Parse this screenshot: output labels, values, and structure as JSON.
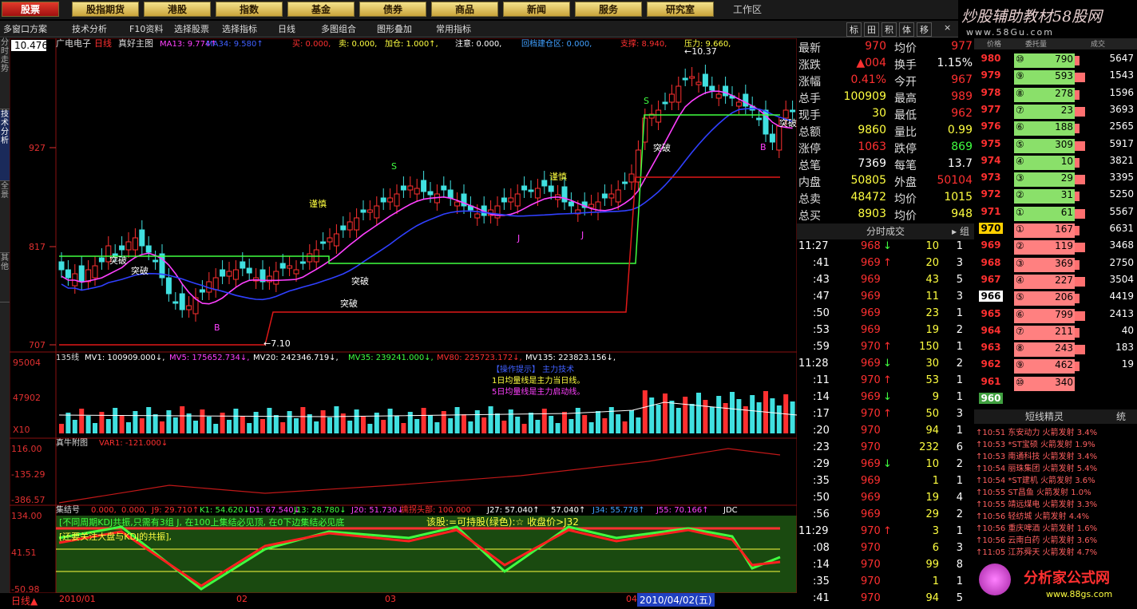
{
  "nav": {
    "items": [
      "股票",
      "股指期货",
      "港股",
      "指数",
      "基金",
      "债券",
      "商品",
      "新闻",
      "服务",
      "研究室"
    ],
    "active": 0,
    "workspace": "工作区"
  },
  "brand": {
    "text": "炒股辅助教材58股网",
    "sub": "www.58Gu.com"
  },
  "toolbar": {
    "items": [
      "多窗口方案",
      "技术分析",
      "F10资料",
      "选择股票",
      "选择指标",
      "日线",
      "多图组合",
      "图形叠加",
      "常用指标"
    ],
    "right_tools": [
      "标",
      "田",
      "积",
      "体",
      "移"
    ],
    "close": "×"
  },
  "sidebar": {
    "tabs": [
      "分时走势",
      "技术分析",
      "全景",
      "其他"
    ]
  },
  "main": {
    "price_label": "10.476",
    "title_stock": "广电电子",
    "title_period": "日线",
    "title_main": "真好主图",
    "indicators": [
      {
        "text": "MA13: 9.774↑",
        "color": "#ff40ff"
      },
      {
        "text": "MA34:  9.580↑",
        "color": "#4060ff"
      },
      {
        "text": "买: 0.000,",
        "color": "#ff3030"
      },
      {
        "text": "卖: 0.000,",
        "color": "#ffff40"
      },
      {
        "text": "加仓: 1.000↑,",
        "color": "#ffff40"
      },
      {
        "text": "注意: 0.000,",
        "color": "#ffffff"
      },
      {
        "text": "回档建仓区: 0.000,",
        "color": "#40a0ff"
      },
      {
        "text": "支撑: 8.940,",
        "color": "#ff3030"
      },
      {
        "text": "压力: 9.660,",
        "color": "#ffff40"
      }
    ],
    "y_ticks": [
      "927",
      "817",
      "707"
    ],
    "annotations": {
      "high": "10.37",
      "low": "7.10",
      "tupo": "突破",
      "jinshen": "谨慎",
      "s_mark": "S",
      "b_mark": "B",
      "j_mark": "J"
    }
  },
  "volume": {
    "title": "135线",
    "ind": [
      {
        "text": "MV1: 100909.000↓,",
        "color": "#ffffff"
      },
      {
        "text": "MV5: 175652.734↓,",
        "color": "#ff40ff"
      },
      {
        "text": "MV20: 242346.719↓,",
        "color": "#ffffff"
      },
      {
        "text": "MV35: 239241.000↓,",
        "color": "#40ff40"
      },
      {
        "text": "MV80: 225723.172↓,",
        "color": "#ff3030"
      },
      {
        "text": "MV135: 223823.156↓,",
        "color": "#ffffff"
      }
    ],
    "y_ticks": [
      "95004",
      "47902",
      "X10"
    ],
    "legend": [
      "【操作提示】 主力技术",
      "1日均量线是主力当日线。",
      "5日均量线是主力启动线。"
    ]
  },
  "sub1": {
    "title": "真牛附图",
    "ind": "VAR1: -121.000↓",
    "y_ticks": [
      "116.00",
      "-135.29",
      "-386.57"
    ]
  },
  "sub2": {
    "title": "集结号",
    "ind": [
      {
        "text": "0.000,",
        "color": "#ff3030"
      },
      {
        "text": "0.000,",
        "color": "#ff3030"
      },
      {
        "text": "J9: 29.710↑",
        "color": "#ff3030"
      },
      {
        "text": "K1: 54.620↓",
        "color": "#40ff40"
      },
      {
        "text": "D1: 67.540↓",
        "color": "#ff40ff"
      },
      {
        "text": "J13: 28.780↓",
        "color": "#40ff40"
      },
      {
        "text": "J20: 51.730↓",
        "color": "#ff40ff"
      },
      {
        "text": "擒拐头部: 100.000",
        "color": "#ff3030"
      },
      {
        "text": "J27: 57.040↑",
        "color": "#ffffff"
      },
      {
        "text": "57.040↑",
        "color": "#ffffff"
      },
      {
        "text": "J34: 55.778↑",
        "color": "#40a0ff"
      },
      {
        "text": "J55: 70.166↑",
        "color": "#ff40ff"
      },
      {
        "text": "JDC",
        "color": "#ffffff"
      }
    ],
    "y_ticks": [
      "134.00",
      "41.51",
      "-50.98"
    ],
    "text1": "[不同周期KDJ共振,只需有3组 J, 在100上集结必见顶, 在0下边集结必见底",
    "text2": "该股:=可持股(绿色):☆  收盘价>J32",
    "text3": "[还要关注大盘与KDJ的共振],"
  },
  "bottom": {
    "period": "日线▲",
    "dates": [
      "2010/01",
      "02",
      "03",
      "04"
    ],
    "cursor_date": "2010/04/02(五)"
  },
  "quote": {
    "rows": [
      {
        "l": "最新",
        "v": "970",
        "vc": "#ff3030",
        "l2": "均价",
        "v2": "977",
        "v2c": "#ff3030"
      },
      {
        "l": "涨跌",
        "v": "▲004",
        "vc": "#ff3030",
        "l2": "换手",
        "v2": "1.15%",
        "v2c": "#ffffff"
      },
      {
        "l": "涨幅",
        "v": "0.41%",
        "vc": "#ff3030",
        "l2": "今开",
        "v2": "967",
        "v2c": "#ff3030"
      },
      {
        "l": "总手",
        "v": "100909",
        "vc": "#ffff40",
        "l2": "最高",
        "v2": "989",
        "v2c": "#ff3030"
      },
      {
        "l": "现手",
        "v": "30",
        "vc": "#ffff40",
        "l2": "最低",
        "v2": "962",
        "v2c": "#ff3030"
      },
      {
        "l": "总额",
        "v": "9860",
        "vc": "#ffff40",
        "l2": "量比",
        "v2": "0.99",
        "v2c": "#ffff40"
      },
      {
        "l": "涨停",
        "v": "1063",
        "vc": "#ff3030",
        "l2": "跌停",
        "v2": "869",
        "v2c": "#40ff40"
      },
      {
        "l": "总笔",
        "v": "7369",
        "vc": "#ffffff",
        "l2": "每笔",
        "v2": "13.7",
        "v2c": "#ffffff"
      },
      {
        "l": "内盘",
        "v": "50805",
        "vc": "#ffff40",
        "l2": "外盘",
        "v2": "50104",
        "v2c": "#ff3030"
      },
      {
        "l": "总卖",
        "v": "48472",
        "vc": "#ffff40",
        "l2": "均价",
        "v2": "1015",
        "v2c": "#ffff40"
      },
      {
        "l": "总买",
        "v": "8903",
        "vc": "#ffff40",
        "l2": "均价",
        "v2": "948",
        "v2c": "#ffff40"
      }
    ]
  },
  "trades": {
    "header": "分时成交",
    "side": "组",
    "rows": [
      {
        "t": "11:27",
        "p": "968",
        "a": "↓",
        "v": "10",
        "n": "1"
      },
      {
        "t": ":41",
        "p": "969",
        "a": "↑",
        "v": "20",
        "n": "3"
      },
      {
        "t": ":43",
        "p": "969",
        "a": "",
        "v": "43",
        "n": "5"
      },
      {
        "t": ":47",
        "p": "969",
        "a": "",
        "v": "11",
        "n": "3"
      },
      {
        "t": ":50",
        "p": "969",
        "a": "",
        "v": "23",
        "n": "1"
      },
      {
        "t": ":53",
        "p": "969",
        "a": "",
        "v": "19",
        "n": "2"
      },
      {
        "t": ":59",
        "p": "970",
        "a": "↑",
        "v": "150",
        "n": "1"
      },
      {
        "t": "11:28",
        "p": "969",
        "a": "↓",
        "v": "30",
        "n": "2"
      },
      {
        "t": ":11",
        "p": "970",
        "a": "↑",
        "v": "53",
        "n": "1"
      },
      {
        "t": ":14",
        "p": "969",
        "a": "↓",
        "v": "9",
        "n": "1"
      },
      {
        "t": ":17",
        "p": "970",
        "a": "↑",
        "v": "50",
        "n": "3"
      },
      {
        "t": ":20",
        "p": "970",
        "a": "",
        "v": "94",
        "n": "1"
      },
      {
        "t": ":23",
        "p": "970",
        "a": "",
        "v": "232",
        "n": "6"
      },
      {
        "t": ":29",
        "p": "969",
        "a": "↓",
        "v": "10",
        "n": "2"
      },
      {
        "t": ":35",
        "p": "969",
        "a": "",
        "v": "1",
        "n": "1"
      },
      {
        "t": ":50",
        "p": "969",
        "a": "",
        "v": "19",
        "n": "4"
      },
      {
        "t": ":56",
        "p": "969",
        "a": "",
        "v": "29",
        "n": "2"
      },
      {
        "t": "11:29",
        "p": "970",
        "a": "↑",
        "v": "3",
        "n": "1"
      },
      {
        "t": ":08",
        "p": "970",
        "a": "",
        "v": "6",
        "n": "3"
      },
      {
        "t": ":14",
        "p": "970",
        "a": "",
        "v": "99",
        "n": "8"
      },
      {
        "t": ":35",
        "p": "970",
        "a": "",
        "v": "1",
        "n": "1"
      },
      {
        "t": ":41",
        "p": "970",
        "a": "",
        "v": "94",
        "n": "5"
      }
    ]
  },
  "orderbook": {
    "headers": [
      "价格",
      "委托量",
      "成交"
    ],
    "rows": [
      {
        "p": "980",
        "lv": "⑩",
        "v": "790",
        "c": "5647",
        "side": "sell"
      },
      {
        "p": "979",
        "lv": "⑨",
        "v": "593",
        "c": "1543",
        "side": "sell"
      },
      {
        "p": "978",
        "lv": "⑧",
        "v": "278",
        "c": "1596",
        "side": "sell"
      },
      {
        "p": "977",
        "lv": "⑦",
        "v": "23",
        "c": "3693",
        "side": "sell"
      },
      {
        "p": "976",
        "lv": "⑥",
        "v": "188",
        "c": "2565",
        "side": "sell"
      },
      {
        "p": "975",
        "lv": "⑤",
        "v": "309",
        "c": "5917",
        "side": "sell"
      },
      {
        "p": "974",
        "lv": "④",
        "v": "10",
        "c": "3821",
        "side": "sell"
      },
      {
        "p": "973",
        "lv": "③",
        "v": "29",
        "c": "3395",
        "side": "sell"
      },
      {
        "p": "972",
        "lv": "②",
        "v": "31",
        "c": "5250",
        "side": "sell"
      },
      {
        "p": "971",
        "lv": "①",
        "v": "61",
        "c": "5567",
        "side": "sell"
      },
      {
        "p": "970",
        "lv": "①",
        "v": "167",
        "c": "6631",
        "side": "buy"
      },
      {
        "p": "969",
        "lv": "②",
        "v": "119",
        "c": "3468",
        "side": "buy"
      },
      {
        "p": "968",
        "lv": "③",
        "v": "369",
        "c": "2750",
        "side": "buy"
      },
      {
        "p": "967",
        "lv": "④",
        "v": "227",
        "c": "3504",
        "side": "buy"
      },
      {
        "p": "966",
        "lv": "⑤",
        "v": "206",
        "c": "4419",
        "side": "buy"
      },
      {
        "p": "965",
        "lv": "⑥",
        "v": "799",
        "c": "2413",
        "side": "buy"
      },
      {
        "p": "964",
        "lv": "⑦",
        "v": "211",
        "c": "40",
        "side": "buy"
      },
      {
        "p": "963",
        "lv": "⑧",
        "v": "243",
        "c": "183",
        "side": "buy"
      },
      {
        "p": "962",
        "lv": "⑨",
        "v": "462",
        "c": "19",
        "side": "buy"
      },
      {
        "p": "961",
        "lv": "⑩",
        "v": "340",
        "c": "",
        "side": "buy"
      },
      {
        "p": "960",
        "lv": "",
        "v": "",
        "c": "",
        "side": "buy"
      }
    ]
  },
  "shortline": {
    "header": "短线精灵",
    "tab": "统",
    "rows": [
      "↑10:51 东安动力 火箭发射 3.4%",
      "↑10:53 *ST宝硕 火箭发射 1.9%",
      "↑10:53 南通科技 火箭发射 3.4%",
      "↑10:54 丽珠集团 火箭发射 5.4%",
      "↑10:54 *ST建机 火箭发射 3.6%",
      "↑10:55 ST昌鱼 火箭发射 1.0%",
      "↑10:55 靖远煤电 火箭发射 3.3%",
      "↑10:56 轻纺城 火箭发射 4.4%",
      "↑10:56 重庆啤酒 火箭发射 1.6%",
      "↑10:56 云南白药 火箭发射 3.6%",
      "↑11:05 江苏舜天 火箭发射 4.7%"
    ]
  },
  "logo2": {
    "text": "分析家公式网",
    "sub": "www.88gs.com"
  },
  "colors": {
    "up": "#ff3030",
    "down": "#40e0e0",
    "yellow": "#ffff40",
    "green": "#40ff40"
  }
}
